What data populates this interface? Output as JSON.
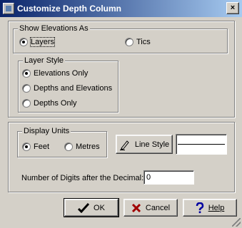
{
  "window": {
    "title": "Customize Depth Column",
    "close_glyph": "×"
  },
  "show_elevations": {
    "legend": "Show Elevations As",
    "options": [
      {
        "label": "Layers",
        "selected": true
      },
      {
        "label": "Tics",
        "selected": false
      }
    ]
  },
  "layer_style": {
    "legend": "Layer Style",
    "options": [
      {
        "label": "Elevations Only",
        "selected": true
      },
      {
        "label": "Depths and Elevations",
        "selected": false
      },
      {
        "label": "Depths Only",
        "selected": false
      }
    ]
  },
  "display_units": {
    "legend": "Display Units",
    "options": [
      {
        "label": "Feet",
        "selected": true
      },
      {
        "label": "Metres",
        "selected": false
      }
    ]
  },
  "line_style": {
    "button_label": "Line Style",
    "icon": "pen-icon",
    "line_color": "#000000"
  },
  "digits": {
    "label": "Number of Digits after the Decimal:",
    "value": "0"
  },
  "buttons": {
    "ok": {
      "label": "OK",
      "icon": "checkmark-icon"
    },
    "cancel": {
      "label": "Cancel",
      "icon": "x-icon",
      "icon_color": "#a00000"
    },
    "help": {
      "label": "Help",
      "icon": "question-icon",
      "icon_color": "#0000a0"
    }
  }
}
